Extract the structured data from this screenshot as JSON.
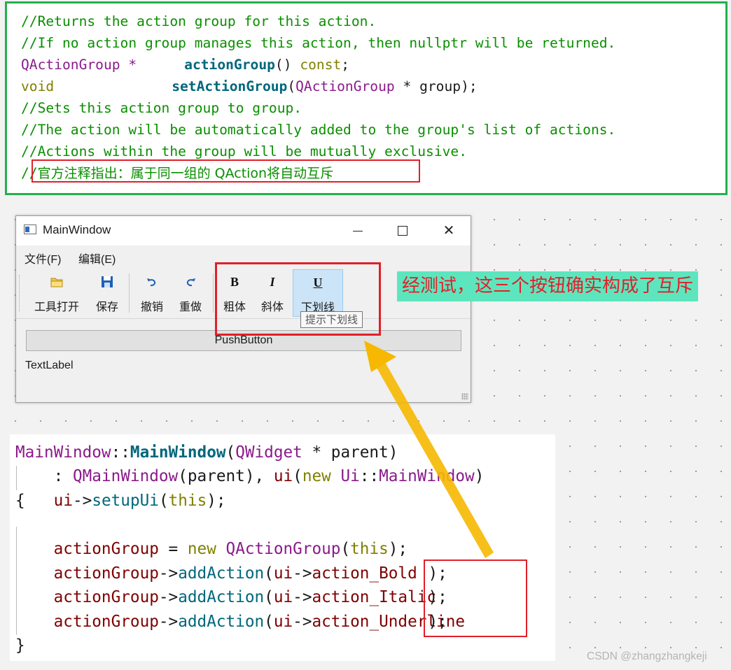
{
  "top_code": {
    "line1": "//Returns the action group for this action.",
    "line2": "//If no action group manages this action, then nullptr will be returned.",
    "line3_type": "QActionGroup *",
    "line3_func": "actionGroup",
    "line3_rest": "()",
    "line3_const": "const",
    "line3_end": ";",
    "line4_type": "void",
    "line4_func": "setActionGroup",
    "line4_open": "(",
    "line4_param_type": "QActionGroup",
    "line4_param": " * group);",
    "line5": "//Sets this action group to group.",
    "line6": "//The action will be automatically added to the group's list of actions.",
    "line7": "//Actions within the group will be mutually exclusive.",
    "line8_prefix": "//",
    "line8_note": "官方注释指出：属于同一组的 QAction将自动互斥"
  },
  "window": {
    "title": "MainWindow",
    "close_glyph": "✕",
    "menu": [
      "文件(F)",
      "编辑(E)"
    ],
    "toolbar": [
      {
        "label": "工具打开",
        "icon": "folder-open-icon"
      },
      {
        "label": "保存",
        "icon": "save-icon"
      },
      {
        "label": "撤销",
        "icon": "undo-icon"
      },
      {
        "label": "重做",
        "icon": "redo-icon"
      },
      {
        "label": "粗体",
        "icon": "bold-icon",
        "glyph": "B"
      },
      {
        "label": "斜体",
        "icon": "italic-icon",
        "glyph": "I"
      },
      {
        "label": "下划线",
        "icon": "underline-icon",
        "glyph": "U"
      }
    ],
    "tooltip": "提示下划线",
    "push_button": "PushButton",
    "text_label": "TextLabel"
  },
  "annotation": "经测试，这三个按钮确实构成了互斥",
  "bottom_code": {
    "l1_cls": "MainWindow",
    "l1_sep": "::",
    "l1_fn": "MainWindow",
    "l1_open": "(",
    "l1_type": "QWidget",
    "l1_rest": " * parent)",
    "l2_colon": "    : ",
    "l2_base": "QMainWindow",
    "l2_mid": "(parent), ",
    "l2_ui": "ui",
    "l2_open": "(",
    "l2_new": "new",
    "l2_space": " ",
    "l2_ns": "Ui",
    "l2_sep": "::",
    "l2_cls": "MainWindow",
    "l2_close": ")",
    "l3_brace": "{",
    "l3_ui": "ui",
    "l3_arrow": "->",
    "l3_call": "setupUi",
    "l3_open": "(",
    "l3_this": "this",
    "l3_close": ");",
    "l5_var": "actionGroup",
    "l5_eq": " = ",
    "l5_new": "new",
    "l5_space": " ",
    "l5_cls": "QActionGroup",
    "l5_open": "(",
    "l5_this": "this",
    "l5_close": ");",
    "add_var": "actionGroup",
    "add_arrow": "->",
    "add_call": "addAction",
    "add_open": "(",
    "add_ui": "ui",
    "add_ui_arrow": "->",
    "actions": [
      "action_Bold",
      "action_Italic",
      "action_Underline"
    ],
    "add_close": ");",
    "end_brace": "}"
  },
  "watermark": "CSDN @zhangzhangkeji",
  "colors": {
    "comment": "#0a8f00",
    "type": "#8b1a8b",
    "function": "#00677c",
    "member": "#7f0000",
    "highlight_border": "#e0202a",
    "panel_border": "#22b14c",
    "annotation_bg": "#5de6bd",
    "arrow": "#f6b800"
  }
}
